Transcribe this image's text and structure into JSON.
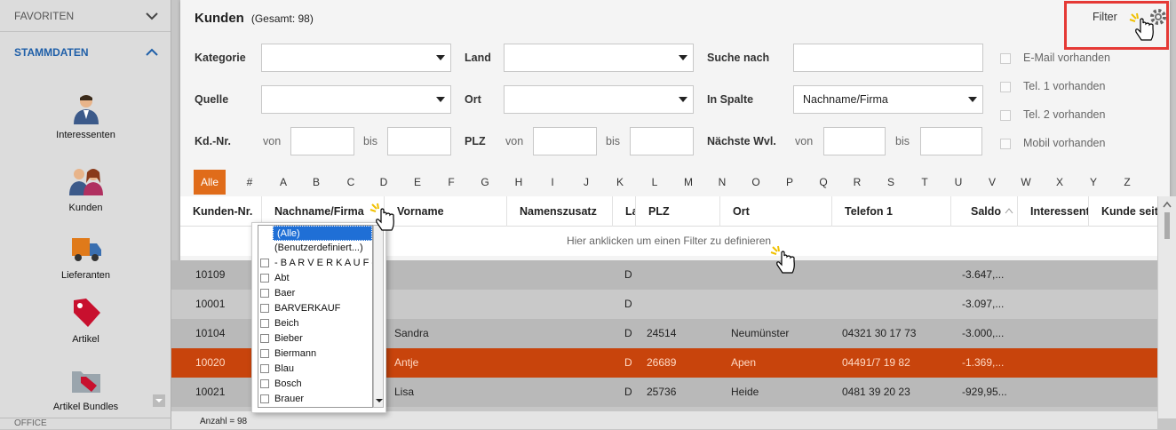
{
  "sidebar": {
    "favoriten": "FAVORITEN",
    "stammdaten": "STAMMDATEN",
    "items": [
      {
        "label": "Interessenten",
        "icon": "person-icon"
      },
      {
        "label": "Kunden",
        "icon": "people-icon"
      },
      {
        "label": "Lieferanten",
        "icon": "truck-icon"
      },
      {
        "label": "Artikel",
        "icon": "tag-icon"
      },
      {
        "label": "Artikel Bundles",
        "icon": "folder-tag-icon"
      }
    ],
    "office": "OFFICE"
  },
  "header": {
    "title": "Kunden",
    "total": "(Gesamt: 98)",
    "filter_label": "Filter"
  },
  "filters": {
    "kategorie": "Kategorie",
    "land": "Land",
    "suche_nach": "Suche nach",
    "quelle": "Quelle",
    "ort": "Ort",
    "in_spalte": "In Spalte",
    "in_spalte_value": "Nachname/Firma",
    "kdnr": "Kd.-Nr.",
    "von": "von",
    "bis": "bis",
    "plz": "PLZ",
    "naechste_wvl": "Nächste Wvl.",
    "email": "E-Mail vorhanden",
    "tel1": "Tel. 1 vorhanden",
    "tel2": "Tel. 2 vorhanden",
    "mobil": "Mobil vorhanden"
  },
  "alphabet": [
    "Alle",
    "#",
    "A",
    "B",
    "C",
    "D",
    "E",
    "F",
    "G",
    "H",
    "I",
    "J",
    "K",
    "L",
    "M",
    "N",
    "O",
    "P",
    "Q",
    "R",
    "S",
    "T",
    "U",
    "V",
    "W",
    "X",
    "Y",
    "Z"
  ],
  "columns": [
    "Kunden-Nr.",
    "Nachname/Firma",
    "Vorname",
    "Namenszusatz",
    "La",
    "PLZ",
    "Ort",
    "Telefon 1",
    "Saldo",
    "Interessent",
    "Kunde seit"
  ],
  "filter_row_text": "Hier anklicken um einen Filter zu definieren",
  "rows": [
    {
      "nr": "10109",
      "vorname": "",
      "la": "D",
      "plz": "",
      "ort": "",
      "tel": "",
      "saldo": "-3.647,..."
    },
    {
      "nr": "10001",
      "vorname": "",
      "la": "D",
      "plz": "",
      "ort": "",
      "tel": "",
      "saldo": "-3.097,..."
    },
    {
      "nr": "10104",
      "vorname": "Sandra",
      "la": "D",
      "plz": "24514",
      "ort": "Neumünster",
      "tel": "04321 30 17 73",
      "saldo": "-3.000,..."
    },
    {
      "nr": "10020",
      "vorname": "Antje",
      "la": "D",
      "plz": "26689",
      "ort": "Apen",
      "tel": "04491/7 19 82",
      "saldo": "-1.369,..."
    },
    {
      "nr": "10021",
      "vorname": "Lisa",
      "la": "D",
      "plz": "25736",
      "ort": "Heide",
      "tel": "0481 39 20 23",
      "saldo": "-929,95..."
    }
  ],
  "dropdown": [
    "(Alle)",
    "(Benutzerdefiniert...)",
    "- B A R V E R K A U F -",
    "Abt",
    "Baer",
    "BARVERKAUF",
    "Beich",
    "Bieber",
    "Biermann",
    "Blau",
    "Bosch",
    "Brauer"
  ],
  "status": "Anzahl = 98",
  "colors": {
    "accent": "#e06c1a",
    "selected_row": "#c8440c",
    "highlight": "#e53935"
  }
}
